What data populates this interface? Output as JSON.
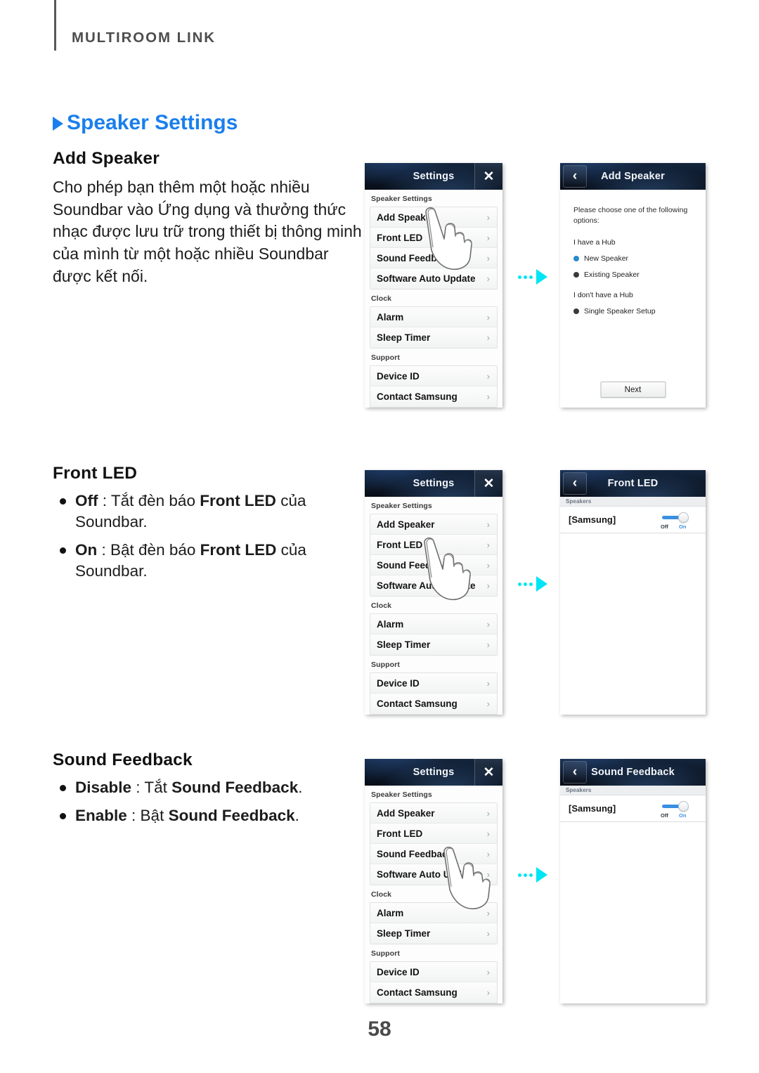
{
  "running_header": {
    "label": "MULTIROOM LINK"
  },
  "page_number": "58",
  "accent_color": "#1a7fed",
  "arrow_color": "#00e5f5",
  "sections": {
    "speaker_settings": {
      "title": "Speaker Settings",
      "add_speaker": {
        "heading": "Add Speaker",
        "paragraph": "Cho phép bạn thêm một hoặc nhiều Soundbar vào Ứng dụng và thưởng thức nhạc được lưu trữ trong thiết bị thông minh của mình từ một hoặc nhiều Soundbar được kết nối."
      },
      "front_led": {
        "heading": "Front LED",
        "bullets": [
          {
            "term": "Off",
            "sep": " : ",
            "text_before": "Tắt đèn báo ",
            "term2": "Front LED",
            "text_after": " của Soundbar."
          },
          {
            "term": "On",
            "sep": " : ",
            "text_before": "Bật đèn báo ",
            "term2": "Front LED",
            "text_after": " của Soundbar."
          }
        ]
      },
      "sound_feedback": {
        "heading": "Sound Feedback",
        "bullets": [
          {
            "term": "Disable",
            "sep": " : ",
            "text_before": "Tắt ",
            "term2": "Sound Feedback",
            "text_after": "."
          },
          {
            "term": "Enable",
            "sep": " : ",
            "text_before": "Bật ",
            "term2": "Sound Feedback",
            "text_after": "."
          }
        ]
      }
    }
  },
  "settings_screen": {
    "title": "Settings",
    "close_label": "✕",
    "chevron": "›",
    "groups": [
      {
        "label": "Speaker Settings",
        "items": [
          "Add Speaker",
          "Front LED",
          "Sound Feedback",
          "Software Auto Update"
        ]
      },
      {
        "label": "Clock",
        "items": [
          "Alarm",
          "Sleep Timer"
        ]
      },
      {
        "label": "Support",
        "items": [
          "Device ID",
          "Contact Samsung"
        ]
      }
    ]
  },
  "add_speaker_screen": {
    "title": "Add Speaker",
    "back_label": "‹",
    "intro": "Please choose one of the following options:",
    "group_hub": "I have a Hub",
    "options_hub": [
      {
        "label": "New Speaker",
        "selected": true
      },
      {
        "label": "Existing Speaker",
        "selected": false
      }
    ],
    "group_nohub": "I don't have a Hub",
    "options_nohub": [
      {
        "label": "Single Speaker Setup",
        "selected": false
      }
    ],
    "next_label": "Next"
  },
  "front_led_screen": {
    "title": "Front LED",
    "back_label": "‹",
    "speakers_label": "Speakers",
    "speaker_name": "[Samsung]",
    "toggle": {
      "off_label": "Off",
      "on_label": "On",
      "state": "On"
    }
  },
  "sound_feedback_screen": {
    "title": "Sound Feedback",
    "back_label": "‹",
    "speakers_label": "Speakers",
    "speaker_name": "[Samsung]",
    "toggle": {
      "off_label": "Off",
      "on_label": "On",
      "state": "On"
    }
  }
}
